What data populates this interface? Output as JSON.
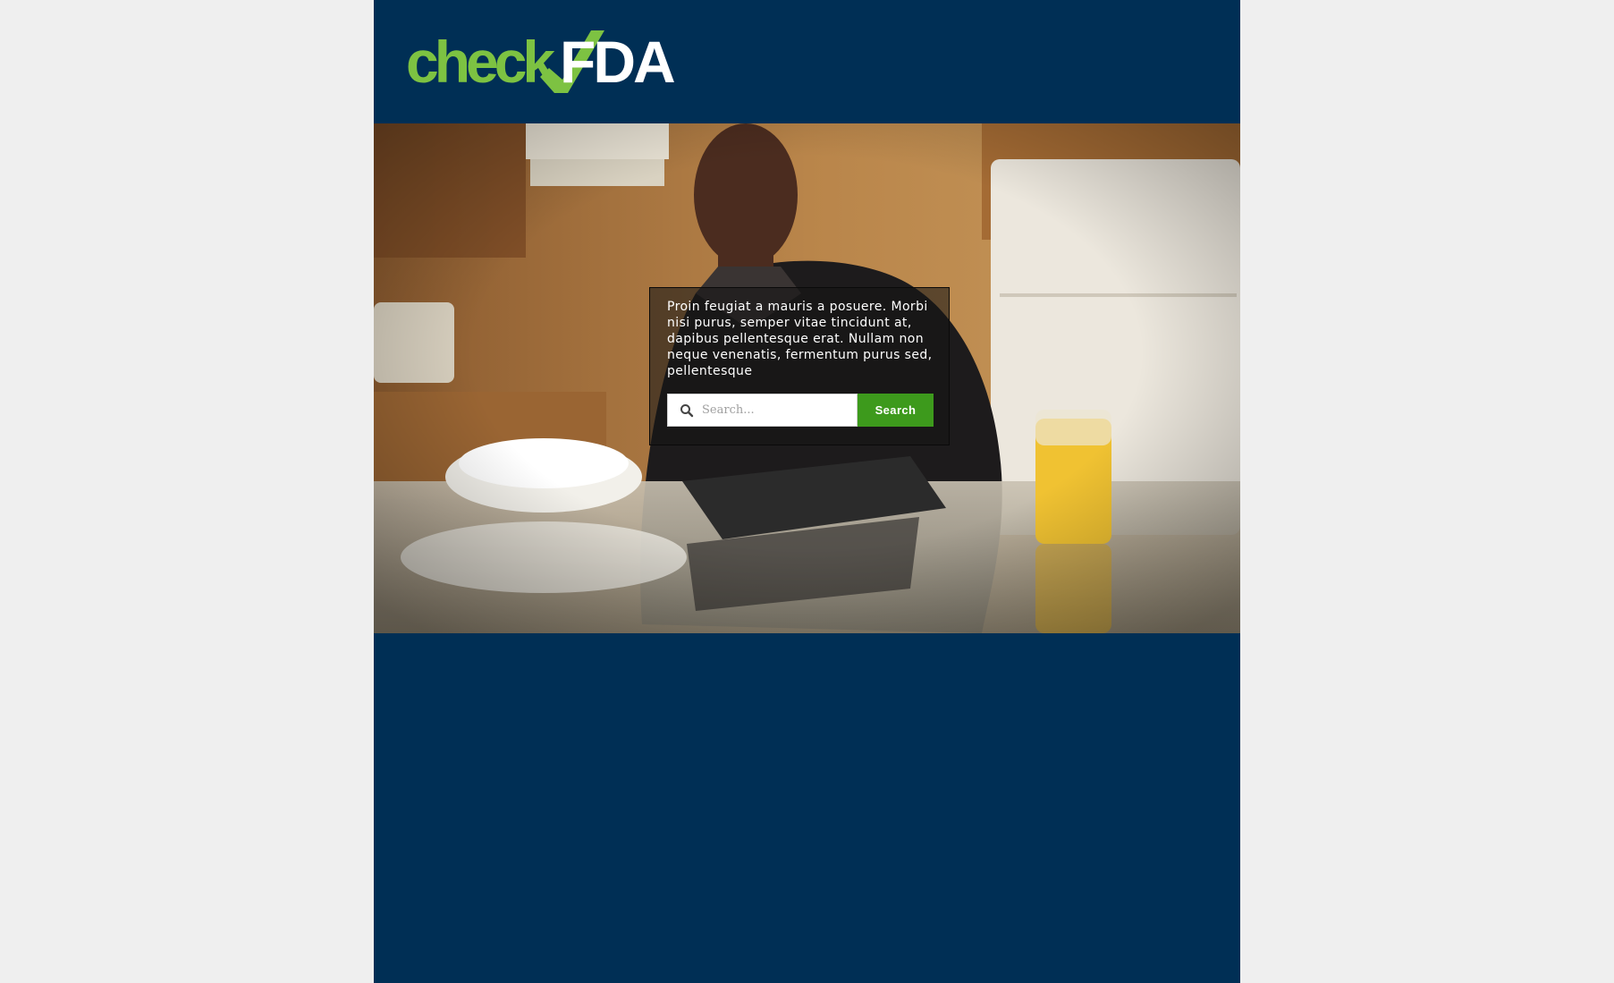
{
  "brand": {
    "logo_text_check": "check",
    "logo_text_fda": "FDA",
    "logo_green": "#7dc242",
    "logo_white": "#ffffff"
  },
  "colors": {
    "page_background": "#efefef",
    "header_background": "#002f55",
    "button_green": "#3d9a1c"
  },
  "hero": {
    "image": "man-using-tablet-in-kitchen",
    "blurb": "Proin feugiat a mauris a posuere. Morbi nisi purus, semper vitae tincidunt at, dapibus pellentesque erat. Nullam non neque venenatis, fermentum purus sed, pellentesque"
  },
  "search": {
    "icon": "search-icon",
    "placeholder": "Search...",
    "value": "",
    "button_label": "Search"
  }
}
